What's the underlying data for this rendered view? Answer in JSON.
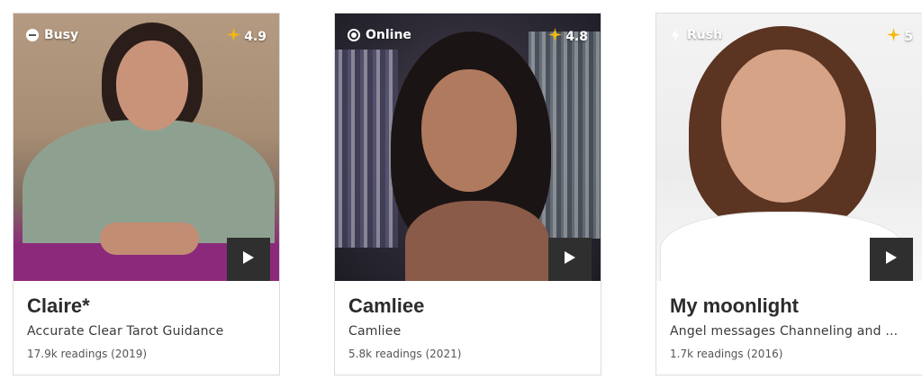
{
  "colors": {
    "star": "#f5b90a",
    "play_bg": "#2f2f2f",
    "name": "#2b2b2b"
  },
  "cards": [
    {
      "status": "Busy",
      "status_icon": "minus-circle-icon",
      "rating": "4.9",
      "name": "Claire*",
      "tagline": "Accurate Clear Tarot Guidance",
      "readings": "17.9k readings (2019)"
    },
    {
      "status": "Online",
      "status_icon": "radio-dot-icon",
      "rating": "4.8",
      "name": "Camliee",
      "tagline": "Camliee",
      "readings": "5.8k readings (2021)"
    },
    {
      "status": "Rush",
      "status_icon": "lightning-icon",
      "rating": "5",
      "name": "My moonlight",
      "tagline": "Angel messages Channeling and ...",
      "readings": "1.7k readings (2016)"
    }
  ]
}
